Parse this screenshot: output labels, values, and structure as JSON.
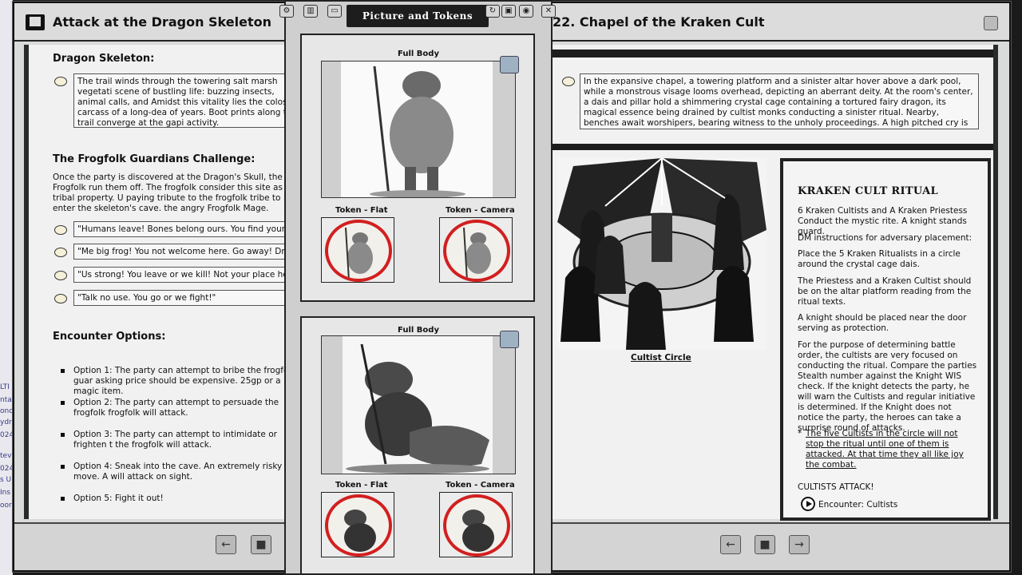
{
  "left_window": {
    "title": "Attack at the Dragon Skeleton",
    "section1_heading": "Dragon Skeleton:",
    "section1_box": "The trail winds through the towering salt marsh vegetati scene of bustling life: buzzing insects, animal calls, and Amidst this vitality lies the colossal carcass of a long-dea of years. Boot prints along the trail converge at the gapi activity.",
    "section2_heading": "The Frogfolk Guardians Challenge:",
    "section2_text": "Once the party is discovered at the Dragon's Skull, the Frogfolk run them off. The frogfolk consider this site as tribal property. U paying tribute to the frogfolk tribe to enter the skeleton's cave. the angry Frogfolk Mage.",
    "quotes": [
      "\"Humans leave! Bones belong ours. You find yours some",
      "\"Me big frog! You not welcome here. Go away! Dragon c",
      "\"Us strong! You leave or we kill! Not your place here!\"",
      "\"Talk no use. You go or we fight!\""
    ],
    "section3_heading": "Encounter Options:",
    "options": [
      "Option 1: The party can attempt to bribe the frogfolk guar asking price should be expensive. 25gp or a magic item.",
      "Option 2: The party can attempt to persuade the frogfolk frogfolk will attack.",
      "Option 3: The party can attempt to intimidate or frighten t the frogfolk will attack.",
      "Option 4: Sneak into the cave. An extremely risky move. A will attack on sight.",
      "Option 5: Fight it out!"
    ]
  },
  "picture_window": {
    "title": "Picture and Tokens",
    "panel1": {
      "full_body": "Full Body",
      "token_flat": "Token - Flat",
      "token_camera": "Token - Camera"
    },
    "panel2": {
      "full_body": "Full Body",
      "token_flat": "Token - Flat",
      "token_camera": "Token - Camera"
    }
  },
  "right_window": {
    "title": "22.  Chapel of the Kraken Cult",
    "intro_box": "In the expansive chapel, a towering platform and a sinister altar hover above a dark pool, while a monstrous visage looms overhead, depicting an aberrant deity. At the room's center, a dais and pillar hold a shimmering crystal cage containing a tortured fairy dragon, its magical essence being drained by cultist monks conducting a sinister ritual. Nearby, benches await worshipers, bearing witness to the unholy proceedings. A high pitched cry is heard coming from inside the crystal cage.",
    "image_caption": "Cultist Circle",
    "ritual_heading": "KRAKEN CULT RITUAL",
    "ritual_paragraphs": [
      "6 Kraken Cultists and A Kraken Priestess Conduct the mystic rite. A knight stands guard.",
      "DM instructions for adversary placement:",
      "Place the 5 Kraken Ritualists in a circle around the crystal cage dais.",
      "The Priestess and a Kraken Cultist should be on the altar platform reading from the ritual texts.",
      "A knight should be placed near the door serving as protection.",
      "For the purpose of determining battle order, the cultists are very focused on conducting the ritual. Compare the parties Stealth number against the Knight WIS check. If the knight detects the party, he will warn the Cultists and regular initiative is determined. If the Knight does not notice the party, the heroes can take a surprise round of attacks."
    ],
    "ritual_note_star": "*",
    "ritual_note": "The five Cultists in the circle will not stop the ritual until one of them is attacked. At that time they all like joy the combat.",
    "attack_line": "CULTISTS ATTACK!",
    "encounter_link": "Encounter: Cultists"
  },
  "desktop_strip": [
    "LTI",
    "ntai",
    "onc",
    "ydr",
    "024",
    "tev",
    "024",
    "s U",
    "Ins",
    "oor"
  ]
}
